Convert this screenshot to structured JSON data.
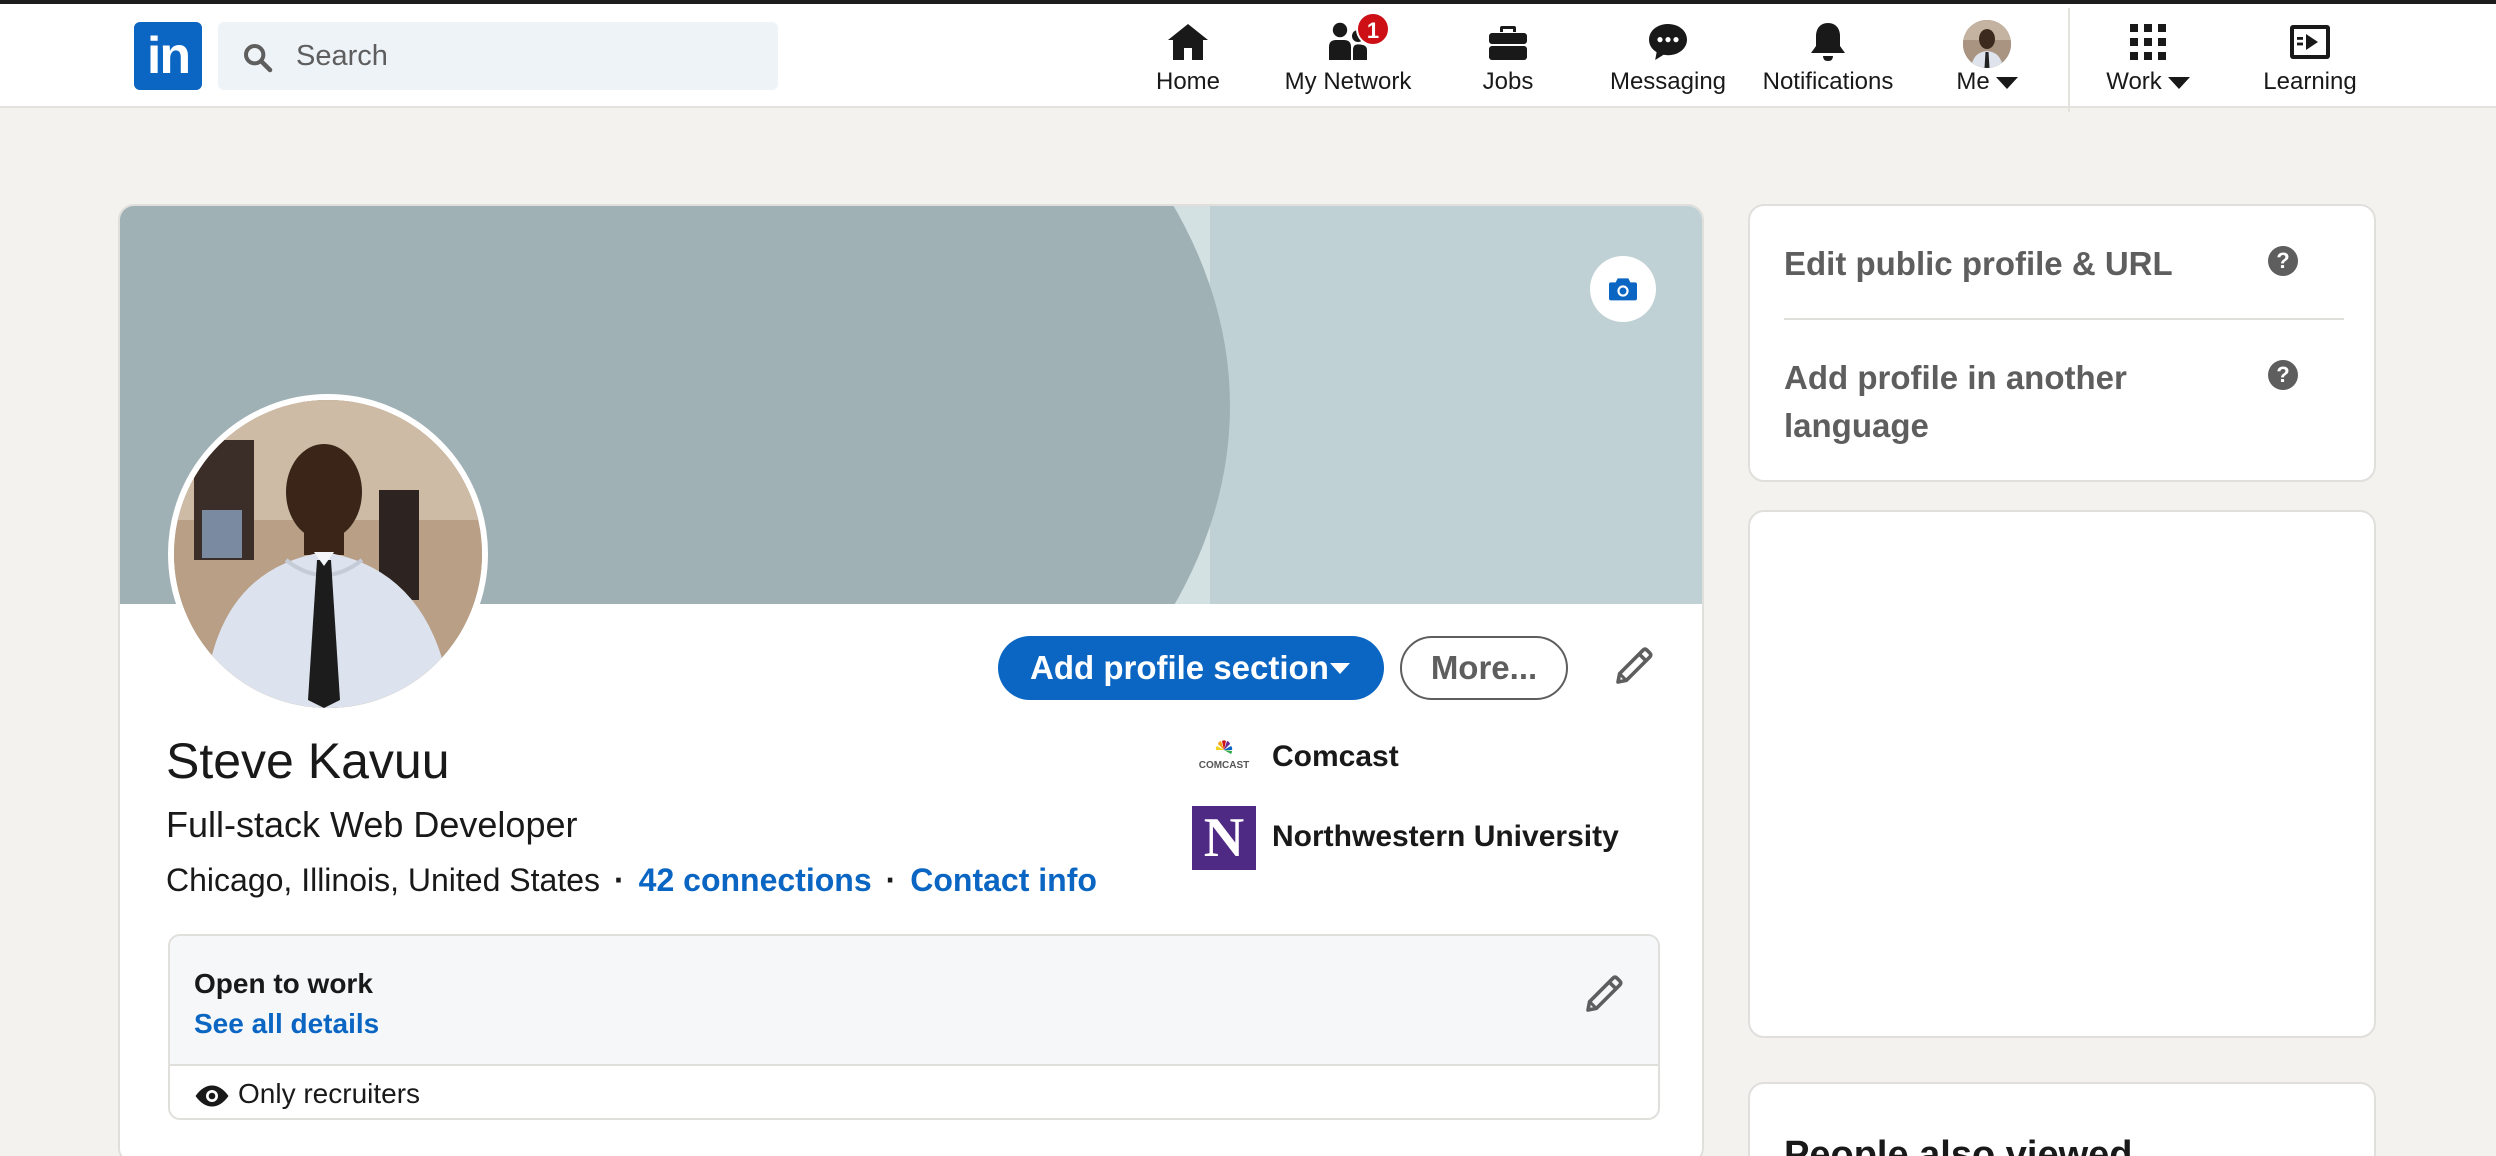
{
  "nav": {
    "logo_text": "in",
    "search_placeholder": "Search",
    "items": [
      {
        "label": "Home",
        "icon": "home-icon"
      },
      {
        "label": "My Network",
        "icon": "network-icon",
        "badge": "1"
      },
      {
        "label": "Jobs",
        "icon": "briefcase-icon"
      },
      {
        "label": "Messaging",
        "icon": "messaging-icon"
      },
      {
        "label": "Notifications",
        "icon": "bell-icon"
      },
      {
        "label": "Me",
        "icon": "avatar"
      },
      {
        "label": "Work",
        "icon": "grid-icon"
      },
      {
        "label": "Learning",
        "icon": "learning-icon"
      }
    ]
  },
  "profile": {
    "name": "Steve Kavuu",
    "headline": "Full-stack Web Developer",
    "location": "Chicago, Illinois, United States",
    "connections": "42 connections",
    "contact": "Contact info",
    "add_section_label": "Add profile section",
    "more_label": "More...",
    "orgs": [
      {
        "name": "Comcast",
        "logo_text": "COMCAST"
      },
      {
        "name": "Northwestern University",
        "logo_text": "N"
      }
    ],
    "open_to_work": {
      "title": "Open to work",
      "details_link": "See all details",
      "visibility": "Only recruiters"
    }
  },
  "sidebar": {
    "edit_public_profile": "Edit public profile & URL",
    "add_language_profile": "Add profile in another language",
    "help_glyph": "?",
    "people_also_viewed": "People also viewed"
  },
  "colors": {
    "brand": "#0a66c2",
    "badge": "#cc1016",
    "background": "#f3f2ef"
  }
}
